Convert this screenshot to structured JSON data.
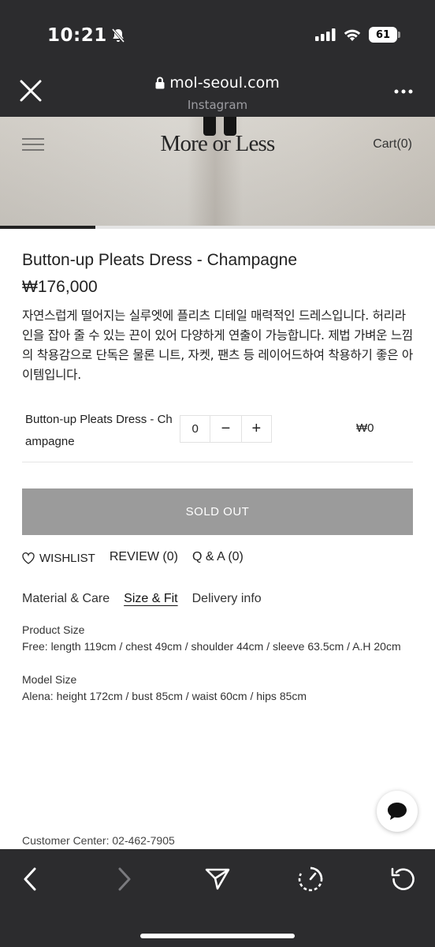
{
  "status": {
    "time": "10:21",
    "battery": "61"
  },
  "browser": {
    "url": "mol-seoul.com",
    "source": "Instagram"
  },
  "header": {
    "brand": "More or Less",
    "cart_label": "Cart(0)"
  },
  "gallery": {
    "progress": 0.22
  },
  "product": {
    "name": "Button-up Pleats Dress - Champagne",
    "price": "₩176,000",
    "description": "자연스럽게 떨어지는 실루엣에 플리츠 디테일 매력적인 드레스입니다. 허리라인을 잡아 줄 수 있는 끈이 있어 다양하게 연출이 가능합니다. 제법 가벼운 느낌의 착용감으로 단독은 물론 니트, 자켓, 팬츠 등 레이어드하여 착용하기 좋은 아이템입니다."
  },
  "option": {
    "name": "Button-up Pleats Dress - Champagne",
    "quantity": "0",
    "minus": "−",
    "plus": "+",
    "price": "₩0"
  },
  "buy": {
    "soldout_label": "SOLD OUT"
  },
  "actions": {
    "wishlist": "WISHLIST",
    "review": "REVIEW (0)",
    "qa": "Q & A (0)"
  },
  "tabs": [
    {
      "label": "Material & Care",
      "active": false
    },
    {
      "label": "Size & Fit",
      "active": true
    },
    {
      "label": "Delivery info",
      "active": false
    }
  ],
  "size_fit": {
    "product_size_title": "Product Size",
    "product_size_text": "Free: length 119cm / chest 49cm / shoulder 44cm / sleeve 63.5cm / A.H 20cm",
    "model_size_title": "Model Size",
    "model_size_text": "Alena: height 172cm / bust 85cm / waist 60cm / hips 85cm"
  },
  "footer": {
    "customer_center": "Customer Center: 02-462-7905"
  },
  "colors": {
    "chrome": "#2c2c2e",
    "soldout": "#9b9b9b",
    "text": "#222222"
  }
}
